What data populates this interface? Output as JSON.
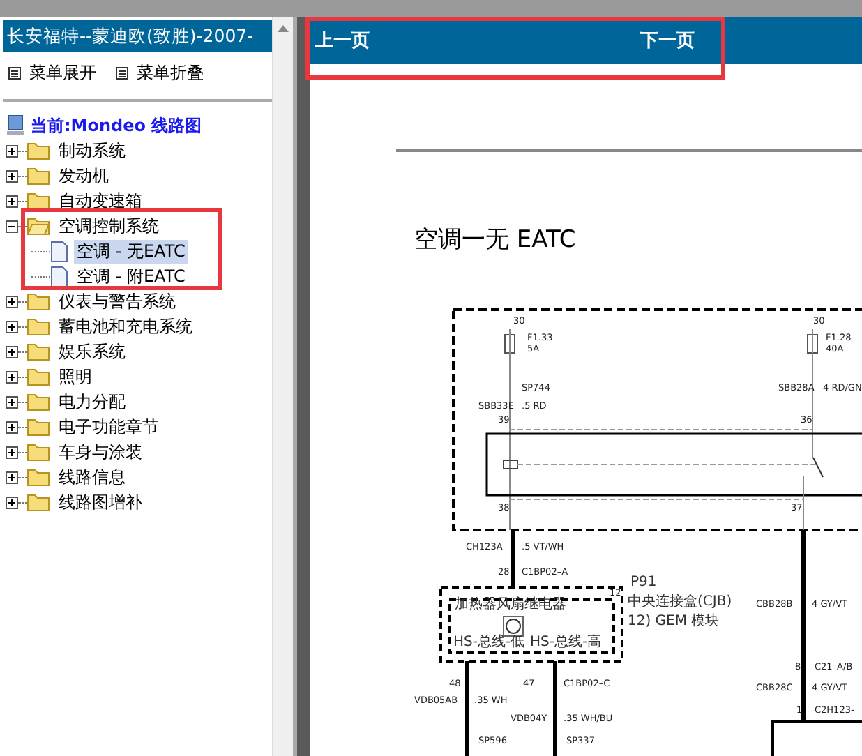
{
  "sidebar": {
    "title": "长安福特--蒙迪欧(致胜)-2007-",
    "menu": [
      {
        "label": "菜单展开"
      },
      {
        "label": "菜单折叠"
      }
    ],
    "current": "当前:Mondeo 线路图",
    "tree": [
      {
        "label": "制动系统",
        "expanded": false,
        "selected": false
      },
      {
        "label": "发动机",
        "expanded": false,
        "selected": false
      },
      {
        "label": "自动变速箱",
        "expanded": false,
        "selected": false
      },
      {
        "label": "空调控制系统",
        "expanded": true,
        "selected": false,
        "children": [
          {
            "label": "空调 - 无EATC",
            "selected": true
          },
          {
            "label": "空调 - 附EATC",
            "selected": false
          }
        ]
      },
      {
        "label": "仪表与警告系统",
        "expanded": false,
        "selected": false
      },
      {
        "label": "蓄电池和充电系统",
        "expanded": false,
        "selected": false
      },
      {
        "label": "娱乐系统",
        "expanded": false,
        "selected": false
      },
      {
        "label": "照明",
        "expanded": false,
        "selected": false
      },
      {
        "label": "电力分配",
        "expanded": false,
        "selected": false
      },
      {
        "label": "电子功能章节",
        "expanded": false,
        "selected": false
      },
      {
        "label": "车身与涂装",
        "expanded": false,
        "selected": false
      },
      {
        "label": "线路信息",
        "expanded": false,
        "selected": false
      },
      {
        "label": "线路图增补",
        "expanded": false,
        "selected": false
      }
    ]
  },
  "nav": {
    "prev": "上一页",
    "next": "下一页"
  },
  "document": {
    "title": "空调一无 EATC",
    "labels": [
      "30",
      "F1.33",
      "5A",
      "30",
      "F1.28",
      "40A",
      "SP744",
      "SBB33E",
      ".5 RD",
      "SBB28A",
      "4 RD/GN",
      "39",
      "36",
      "38",
      "37",
      "CH123A",
      ".5 VT/WH",
      "28",
      "C1BP02–A",
      "12",
      "P91",
      "中央连接盒(CJB)",
      "12) GEM 模块",
      "加热器风扇继电器",
      "HS-总线-低",
      "HS-总线-高",
      "48",
      "47",
      "C1BP02–C",
      "VDB05AB",
      ".35 WH",
      "VDB04Y",
      ".35 WH/BU",
      "SP596",
      "SP337",
      "CBB28B",
      "4 GY/VT",
      "8",
      "C21–A/B",
      "CBB28C",
      "4 GY/VT",
      "1",
      "C2H123-"
    ]
  }
}
